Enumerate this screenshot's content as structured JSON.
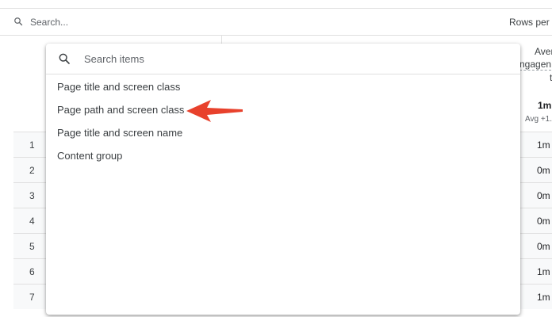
{
  "toolbar": {
    "search_placeholder": "Search...",
    "rows_per_page_label": "Rows per p"
  },
  "metric_column": {
    "header_line1": "Aver",
    "header_line2": "ngagen",
    "header_line3": "t",
    "total_value": "1m",
    "avg_label": "Avg +1..."
  },
  "table": {
    "rows": [
      {
        "index": "1",
        "value": "1m"
      },
      {
        "index": "2",
        "value": "0m"
      },
      {
        "index": "3",
        "value": "0m"
      },
      {
        "index": "4",
        "value": "0m"
      },
      {
        "index": "5",
        "value": "0m"
      },
      {
        "index": "6",
        "value": "1m"
      },
      {
        "index": "7",
        "value": "1m"
      }
    ]
  },
  "dropdown": {
    "search_placeholder": "Search items",
    "items": [
      "Page title and screen class",
      "Page path and screen class",
      "Page title and screen name",
      "Content group"
    ]
  },
  "annotation": {
    "arrow_color": "#e8412c",
    "icon": "left-arrow-icon"
  }
}
